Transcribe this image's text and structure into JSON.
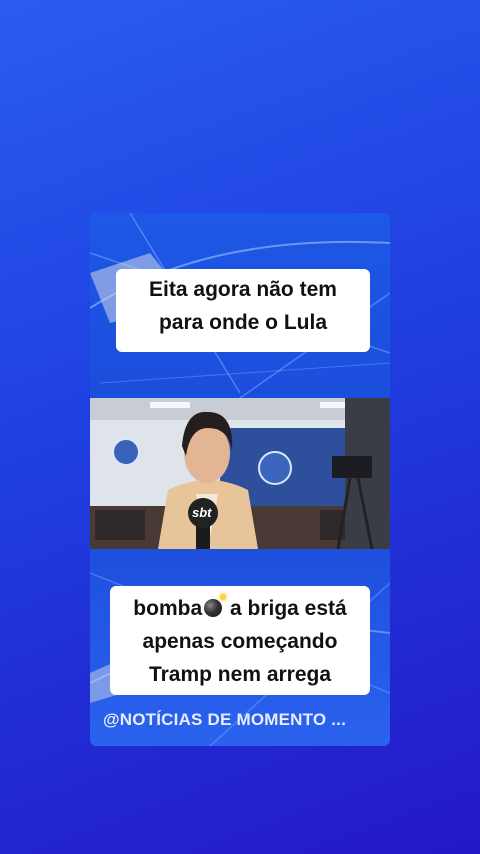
{
  "caption_top": {
    "line1": "Eita agora não tem",
    "line2": "para onde o Lula"
  },
  "caption_bottom": {
    "line1_before": "bomba",
    "line1_after": " a briga está",
    "line2": "apenas começando",
    "line3": "Tramp nem arrega"
  },
  "watermark": "@NOTÍCIAS DE MOMENTO ...",
  "video": {
    "mic_logo": "sbt"
  },
  "colors": {
    "background": "#2340e0",
    "caption_bg": "#ffffff",
    "caption_text": "#111111"
  }
}
